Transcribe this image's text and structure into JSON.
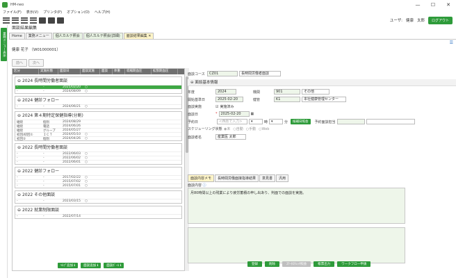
{
  "window": {
    "title": "HM-neo",
    "min": "—",
    "max": "☐",
    "close": "✕"
  },
  "menu": [
    "ファイル(F)",
    "表示(V)",
    "プリンタ(P)",
    "オプション(O)",
    "ヘルプ(H)"
  ],
  "user": {
    "label": "ユーザ:",
    "name1": "健康",
    "name2": "太郎",
    "logout": "ログアウト"
  },
  "sidebar_tab": "業務メニュー表示",
  "page_title": "面談結果編集",
  "tabs": [
    {
      "label": "Home"
    },
    {
      "label": "業務メニュー"
    },
    {
      "label": "個人カルテ照会"
    },
    {
      "label": "個人カルテ照会(詳細)"
    },
    {
      "label": "面談結果編集 ✕"
    }
  ],
  "patient": "健康 花子 （W01000001）",
  "nav": {
    "prev": "前へ",
    "next": "次へ"
  },
  "list_headers": [
    "区分",
    "実施形態",
    "面談日",
    "面談実施",
    "面談",
    "体重",
    "収縮期血圧",
    "拡張期血圧"
  ],
  "groups": [
    {
      "title": "2024 長時間労働者面談",
      "rows": [
        {
          "c1": "-",
          "c2": "-",
          "date": "2025/02/20",
          "mark": "○",
          "sel": true
        },
        {
          "c1": "-",
          "c2": "-",
          "date": "2024/08/09",
          "mark": "○",
          "sel": false
        }
      ]
    },
    {
      "title": "2024 健診フォロー",
      "rows": [
        {
          "c1": "-",
          "c2": "-",
          "date": "2024/06/21",
          "mark": "○",
          "sel": false
        }
      ]
    },
    {
      "title": "2024 第４期特定保健指導(分割)",
      "rows": [
        {
          "c1": "継続",
          "c2": "個別",
          "date": "2024/08/29",
          "mark": "",
          "sel": false
        },
        {
          "c1": "継続",
          "c2": "電話",
          "date": "2024/06/26",
          "mark": "",
          "sel": false
        },
        {
          "c1": "継続",
          "c2": "グループ",
          "date": "2024/05/27",
          "mark": "",
          "sel": false
        },
        {
          "c1": "初回/初回①",
          "c2": "ＩＣＴ",
          "date": "2024/05/10",
          "mark": "○",
          "sel": false
        },
        {
          "c1": "初回②",
          "c2": "個別",
          "date": "2024/04/26",
          "mark": "○",
          "sel": false
        }
      ]
    },
    {
      "title": "2022 長時間労働者面談",
      "rows": [
        {
          "c1": "-",
          "c2": "-",
          "date": "2022/06/03",
          "mark": "○",
          "sel": false
        },
        {
          "c1": "-",
          "c2": "-",
          "date": "2022/06/02",
          "mark": "○",
          "sel": false
        },
        {
          "c1": "-",
          "c2": "-",
          "date": "2022/06/01",
          "mark": "○",
          "sel": false
        }
      ]
    },
    {
      "title": "2022 健診フォロー",
      "rows": [
        {
          "c1": "-",
          "c2": "-",
          "date": "2017/02/22",
          "mark": "○",
          "sel": false
        },
        {
          "c1": "-",
          "c2": "-",
          "date": "2015/07/02",
          "mark": "○",
          "sel": false
        },
        {
          "c1": "-",
          "c2": "-",
          "date": "2015/07/01",
          "mark": "○",
          "sel": false
        }
      ]
    },
    {
      "title": "2022 その他面談",
      "rows": [
        {
          "c1": "-",
          "c2": "-",
          "date": "2023/03/15",
          "mark": "○",
          "sel": false
        }
      ]
    },
    {
      "title": "2022 就業制限面談",
      "rows": [
        {
          "c1": "-",
          "c2": "-",
          "date": "2022/07/14",
          "mark": "",
          "sel": false
        }
      ]
    }
  ],
  "left_buttons": [
    "ﾍﾙﾌﾟ追加 ℹ",
    "面談追加 ℹ",
    "面談ﾎﾞｰﾙ ℹ"
  ],
  "form": {
    "course_label": "面談コース",
    "course_code": "CZ01",
    "course_name": "長時間労働者面談",
    "section_title": "面談基本情報",
    "year_label": "年度",
    "year": "2024",
    "org_label": "機関",
    "org_code": "901",
    "org_name": "その他",
    "start_label": "開始基準日",
    "start": "2025-02-20",
    "site_label": "健管",
    "site_code": "K1",
    "site_name": "本社健康管理センター",
    "done_label": "面談実施",
    "done_check": "実施済み",
    "date_label": "面談日",
    "date": "2025-02-20",
    "reserve_label": "予約日",
    "reserve_ph": "<西暦で入力>",
    "hour": "時",
    "minute": "分",
    "reserve_btn": "候補日照会",
    "plan_label": "予約面談担当",
    "sched_label": "スケジューリング状態",
    "sched_opts": [
      "未",
      "自動",
      "手動",
      "Web"
    ],
    "staff_label": "面談者名",
    "staff": "産業医 太郎"
  },
  "subtabs": [
    "面談内容メモ",
    "長時間労働面接指導結果",
    "意見書",
    "汎用"
  ],
  "content_label": "面談内容",
  "content_text": "月80時間以上の残業により疲労蓄積の申し出あり、判面での面談を実施。",
  "bottom_buttons": [
    {
      "label": "登録",
      "disabled": false
    },
    {
      "label": "削除",
      "disabled": false
    },
    {
      "label": "ｽﾃｰﾀｽﾁｪｯｸ照会",
      "disabled": true
    },
    {
      "label": "帳票出力",
      "disabled": false
    },
    {
      "label": "ワークフロー申請",
      "disabled": false
    }
  ]
}
